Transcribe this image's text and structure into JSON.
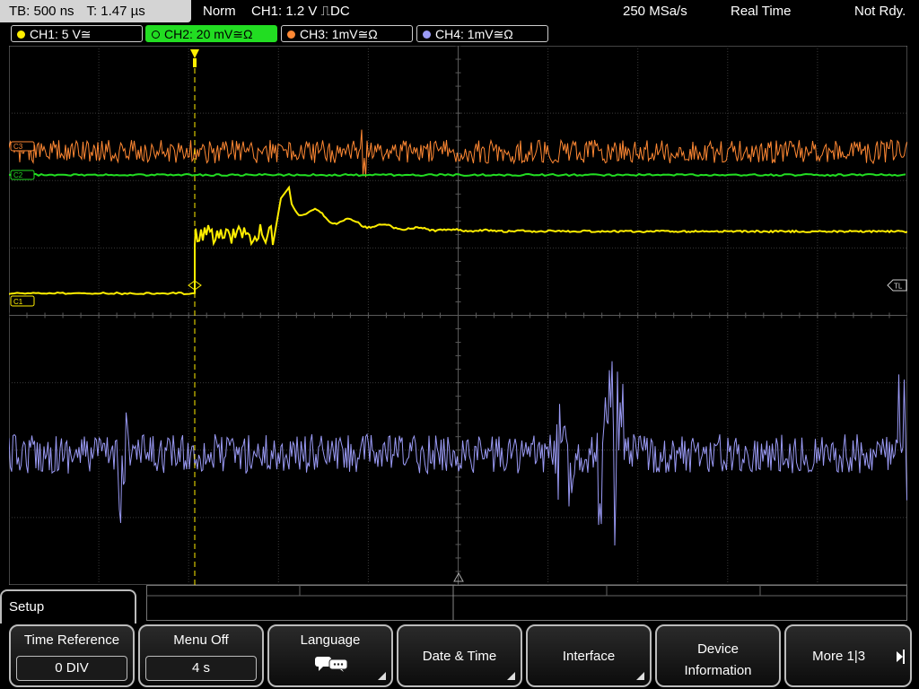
{
  "status_bar": {
    "timebase": "TB: 500 ns",
    "trigger_time": "T: 1.47 µs",
    "trigger_mode": "Norm",
    "trigger_source": "CH1: 1.2 V ⎍DC",
    "sample_rate": "250 MSa/s",
    "acq_mode": "Real Time",
    "status": "Not Rdy."
  },
  "channels": [
    {
      "label": "CH1: 5 V≅",
      "color": "#ffee00",
      "active": false
    },
    {
      "label": "CH2: 20 mV≅Ω",
      "color": "#22dd22",
      "active": true
    },
    {
      "label": "CH3: 1mV≅Ω",
      "color": "#ff8833",
      "active": false
    },
    {
      "label": "CH4: 1mV≅Ω",
      "color": "#9a9af5",
      "active": false
    }
  ],
  "markers": {
    "ch3": "C3",
    "ch2": "C2",
    "ch1": "C1",
    "trigger_level": "TL"
  },
  "menu": {
    "title": "Setup",
    "softkeys": [
      {
        "label": "Time Reference",
        "value": "0 DIV"
      },
      {
        "label": "Menu Off",
        "value": "4 s"
      },
      {
        "label": "Language",
        "icon": "speech-bubble-icon"
      },
      {
        "label": "Date & Time"
      },
      {
        "label": "Interface"
      },
      {
        "label": "Device Information"
      },
      {
        "label": "More 1|3"
      }
    ]
  }
}
